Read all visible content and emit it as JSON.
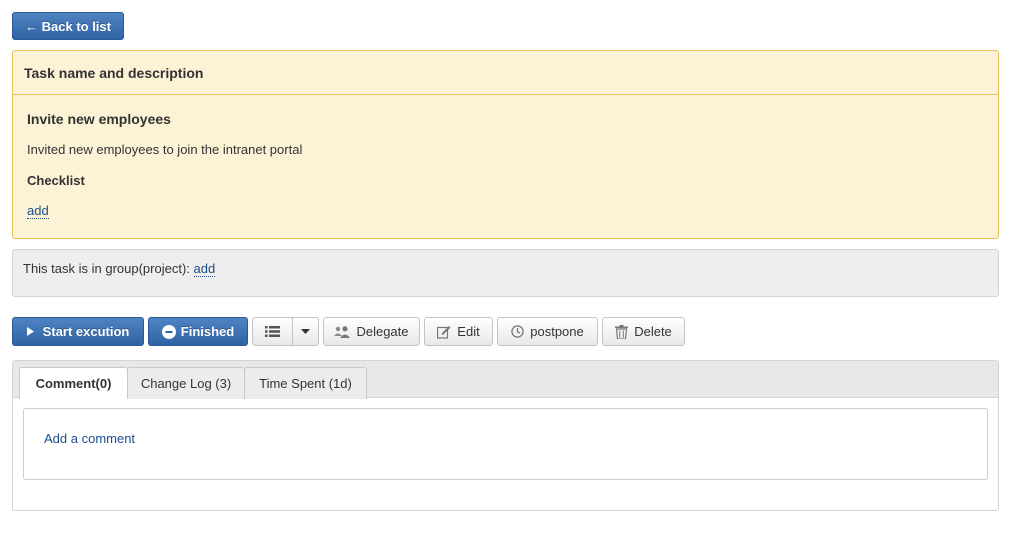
{
  "back_button": {
    "label": "← Back to list"
  },
  "task_panel": {
    "header": "Task name and description",
    "title": "Invite new employees",
    "description": "Invited new employees to join the intranet portal",
    "checklist_title": "Checklist",
    "checklist_add": "add"
  },
  "group_panel": {
    "text": "This task is in group(project):",
    "add_link": "add"
  },
  "actions": {
    "start": "Start excution",
    "finished": "Finished",
    "delegate": "Delegate",
    "edit": "Edit",
    "postpone": "postpone",
    "delete": "Delete"
  },
  "tabs": [
    {
      "label": "Comment(0)",
      "active": true
    },
    {
      "label": "Change Log (3)",
      "active": false
    },
    {
      "label": "Time Spent (1d)",
      "active": false
    }
  ],
  "comments": {
    "add_link": "Add a comment"
  },
  "colors": {
    "primary_button": "#3a6fb0",
    "task_panel_bg": "#fcf2d6",
    "task_panel_border": "#e9c25c",
    "link": "#1a4f8c"
  }
}
